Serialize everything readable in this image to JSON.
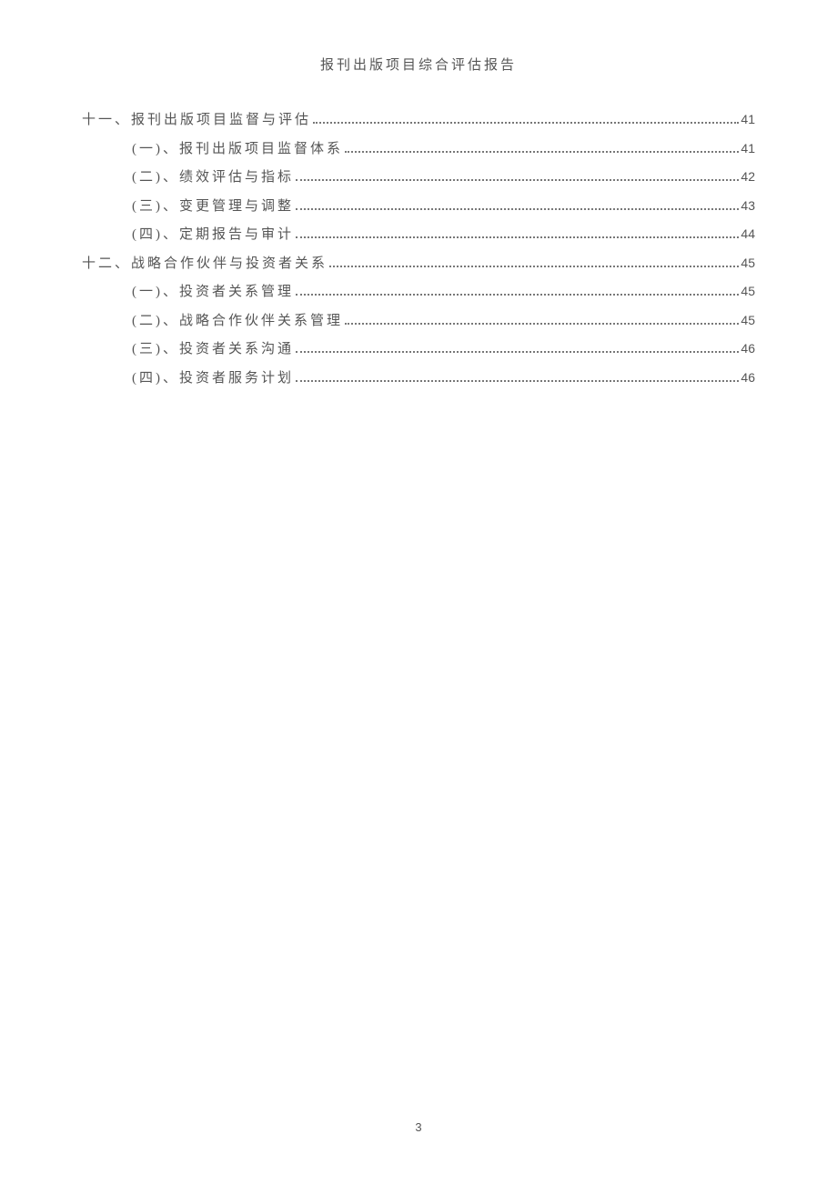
{
  "header": {
    "title": "报刊出版项目综合评估报告"
  },
  "toc": [
    {
      "level": 1,
      "label": "十一、报刊出版项目监督与评估",
      "page": "41"
    },
    {
      "level": 2,
      "label": "(一)、报刊出版项目监督体系",
      "page": "41"
    },
    {
      "level": 2,
      "label": "(二)、绩效评估与指标",
      "page": "42"
    },
    {
      "level": 2,
      "label": "(三)、变更管理与调整",
      "page": "43"
    },
    {
      "level": 2,
      "label": "(四)、定期报告与审计",
      "page": "44"
    },
    {
      "level": 1,
      "label": "十二、战略合作伙伴与投资者关系",
      "page": "45"
    },
    {
      "level": 2,
      "label": "(一)、投资者关系管理",
      "page": "45"
    },
    {
      "level": 2,
      "label": "(二)、战略合作伙伴关系管理",
      "page": "45"
    },
    {
      "level": 2,
      "label": "(三)、投资者关系沟通",
      "page": "46"
    },
    {
      "level": 2,
      "label": "(四)、投资者服务计划",
      "page": "46"
    }
  ],
  "footer": {
    "page_number": "3"
  }
}
